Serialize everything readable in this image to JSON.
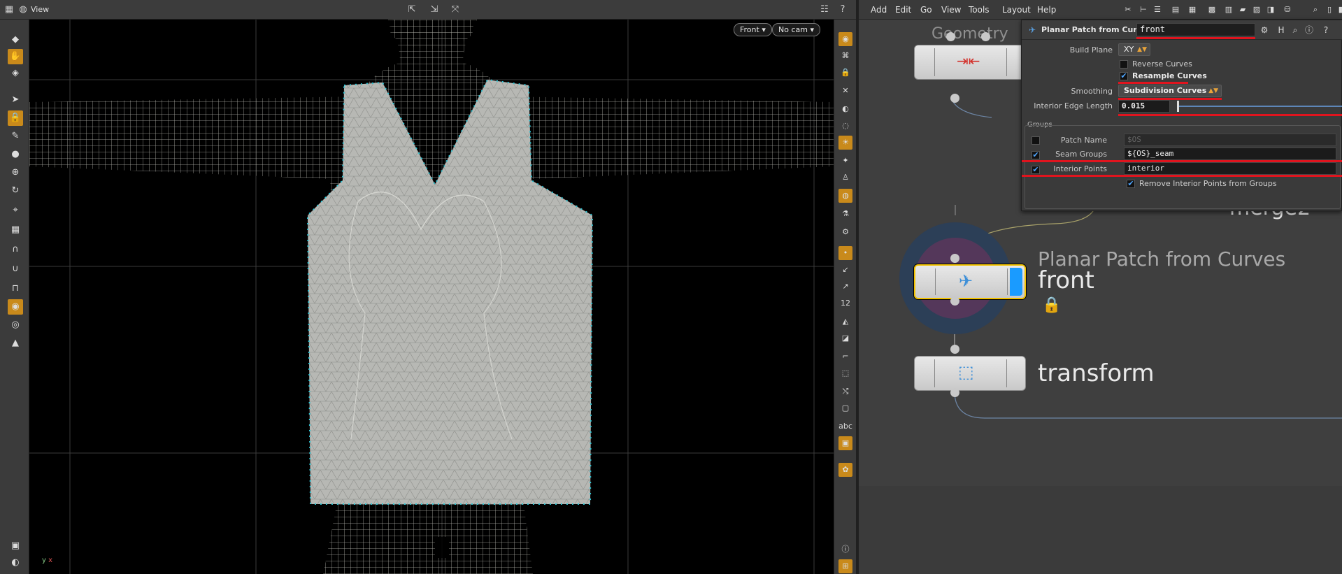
{
  "viewer": {
    "title": "View",
    "camera_view": "Front",
    "camera": "No cam",
    "axis_y": "y",
    "axis_x": "x"
  },
  "menubar": {
    "items": [
      "Add",
      "Edit",
      "Go",
      "View",
      "Tools",
      "Layout",
      "Help"
    ]
  },
  "network": {
    "bg_label": "Geometry",
    "merge_label": "merge2",
    "selected_node_type": "Planar Patch from Curves",
    "selected_node_name": "front",
    "transform_node_name": "transform"
  },
  "params": {
    "title": "Planar Patch from Curves",
    "node_name": "front",
    "build_plane_label": "Build Plane",
    "build_plane_value": "XY",
    "reverse_curves_label": "Reverse Curves",
    "reverse_curves_checked": false,
    "resample_curves_label": "Resample Curves",
    "resample_curves_checked": true,
    "smoothing_label": "Smoothing",
    "smoothing_value": "Subdivision Curves",
    "interior_edge_length_label": "Interior Edge Length",
    "interior_edge_length_value": "0.015",
    "groups_label": "Groups",
    "patch_name_label": "Patch Name",
    "patch_name_value": "$OS",
    "patch_name_enabled": false,
    "seam_groups_label": "Seam Groups",
    "seam_groups_value": "${OS}_seam",
    "seam_groups_enabled": true,
    "interior_points_label": "Interior Points",
    "interior_points_value": "interior",
    "interior_points_enabled": true,
    "remove_interior_label": "Remove Interior Points from Groups",
    "remove_interior_checked": true
  },
  "colors": {
    "selected_node_outline": "#f2c200",
    "selected_flag": "#1a9bff",
    "annotation_red": "#e0141e",
    "mesh_fill": "#b9bab6",
    "mesh_points": "#31c6d6"
  }
}
